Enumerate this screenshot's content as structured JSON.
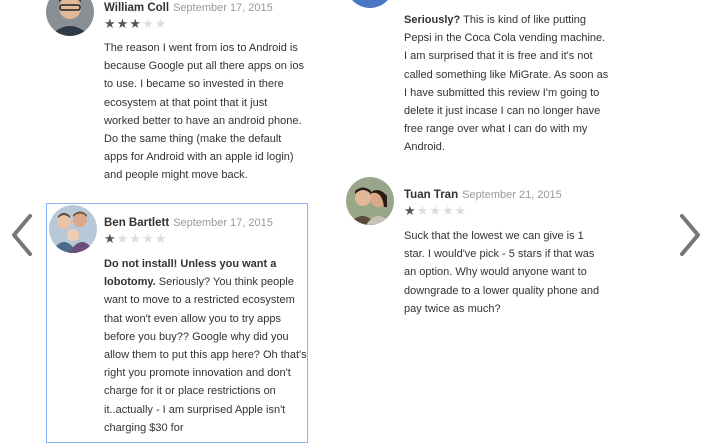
{
  "navigation": {
    "prev_icon": "chevron-left-icon",
    "next_icon": "chevron-right-icon"
  },
  "reviews": [
    {
      "author": "William Coll",
      "date": "September 17, 2015",
      "rating": 3,
      "max_rating": 5,
      "title": "",
      "text": "The reason I went from ios to Android is because Google put all there apps on ios to use. I became so invested in there ecosystem at that point that it just worked better to have an android phone. Do the same thing (make the default apps for Android with an apple id login) and people might move back."
    },
    {
      "author": "Ben Bartlett",
      "date": "September 17, 2015",
      "rating": 1,
      "max_rating": 5,
      "title": "Do not install! Unless you want a lobotomy.",
      "text": "Seriously? You think people want to move to a restricted ecosystem that won't even allow you to try apps before you buy?? Google why did you allow them to put this app here? Oh that's right you promote innovation and don't charge for it or place restrictions on it..actually - I am surprised Apple isn't charging $30 for"
    },
    {
      "author": "",
      "date": "",
      "rating": 0,
      "max_rating": 5,
      "title": "Seriously?",
      "text": "This is kind of like putting Pepsi in the Coca Cola vending machine. I am surprised that it is free and it's not called something like MiGrate. As soon as I have submitted this review I'm going to delete it just incase I can no longer have free range over what I can do with my Android."
    },
    {
      "author": "Tuan Tran",
      "date": "September 21, 2015",
      "rating": 1,
      "max_rating": 5,
      "title": "",
      "text": "Suck that the lowest we can give is 1 star. I would've pick - 5 stars if that was an option. Why would anyone want to downgrade to a lower quality phone and pay twice as much?"
    }
  ],
  "colors": {
    "selected_border": "#8ab4f8",
    "star_filled": "#555555",
    "star_empty": "#dddddd",
    "date_text": "#999999"
  }
}
